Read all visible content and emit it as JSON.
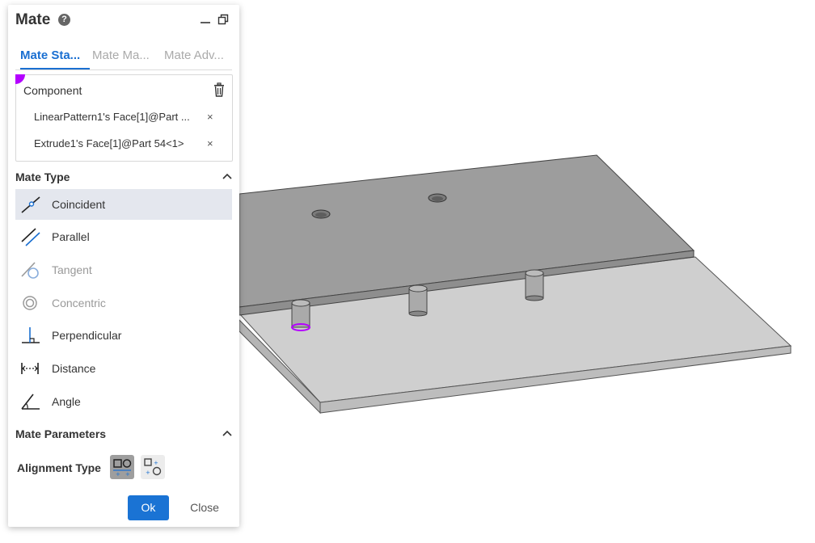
{
  "panel": {
    "title": "Mate",
    "help_symbol": "?",
    "tabs": [
      {
        "label": "Mate Sta..."
      },
      {
        "label": "Mate Ma..."
      },
      {
        "label": "Mate Adv..."
      }
    ],
    "component": {
      "label": "Component",
      "items": [
        {
          "text": "LinearPattern1's Face[1]@Part ...",
          "remove": "×"
        },
        {
          "text": "Extrude1's Face[1]@Part 54<1>",
          "remove": "×"
        }
      ]
    },
    "mate_type": {
      "title": "Mate Type",
      "items": [
        {
          "label": "Coincident",
          "icon": "coincident-icon",
          "selected": true,
          "enabled": true
        },
        {
          "label": "Parallel",
          "icon": "parallel-icon",
          "selected": false,
          "enabled": true
        },
        {
          "label": "Tangent",
          "icon": "tangent-icon",
          "selected": false,
          "enabled": false
        },
        {
          "label": "Concentric",
          "icon": "concentric-icon",
          "selected": false,
          "enabled": false
        },
        {
          "label": "Perpendicular",
          "icon": "perpendicular-icon",
          "selected": false,
          "enabled": true
        },
        {
          "label": "Distance",
          "icon": "distance-icon",
          "selected": false,
          "enabled": true
        },
        {
          "label": "Angle",
          "icon": "angle-icon",
          "selected": false,
          "enabled": true
        }
      ]
    },
    "mate_parameters": {
      "title": "Mate Parameters",
      "alignment_label": "Alignment Type"
    },
    "buttons": {
      "ok": "Ok",
      "close": "Close"
    }
  },
  "colors": {
    "accent": "#1a6fd1",
    "selection_highlight": "#b400ff",
    "selected_row": "#e4e7ee"
  }
}
